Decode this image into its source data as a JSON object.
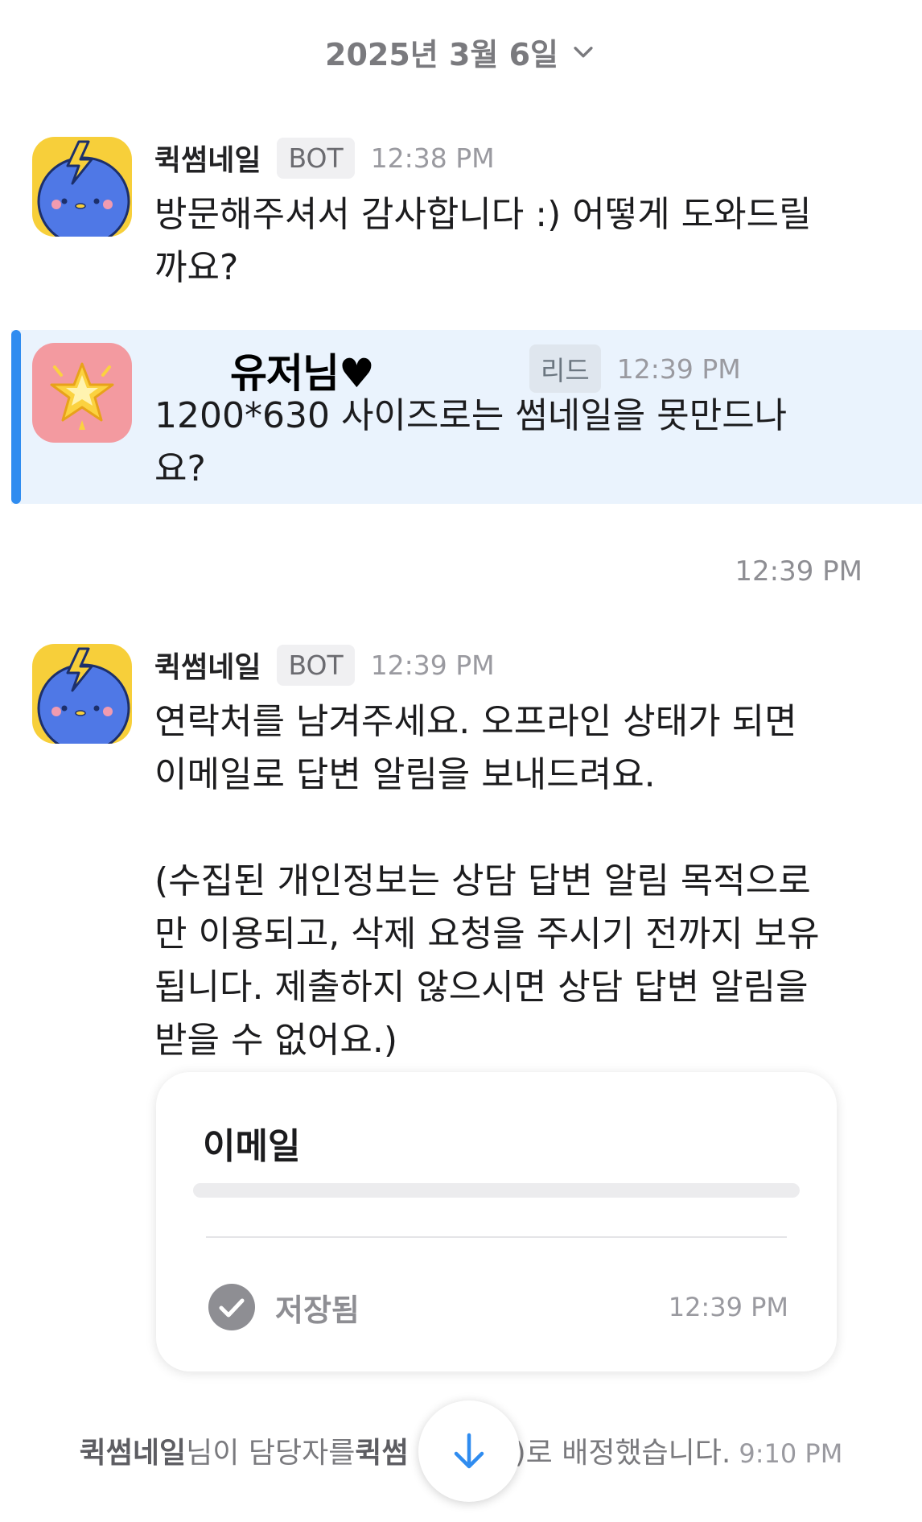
{
  "date_header": "2025년 3월 6일",
  "messages": [
    {
      "sender": "퀵썸네일",
      "badge": "BOT",
      "time": "12:38 PM",
      "text": "방문해주셔서 감사합니다 :) 어떻게 도와드릴\n까요?"
    },
    {
      "sender": "유저님♥",
      "badge": "리드",
      "time": "12:39 PM",
      "text": "1200*630 사이즈로는 썸네일을 못만드나\n요?"
    },
    {
      "sender": "퀵썸네일",
      "badge": "BOT",
      "time": "12:39 PM",
      "text": "연락처를 남겨주세요. 오프라인 상태가 되면\n이메일로 답변 알림을 보내드려요.\n\n(수집된 개인정보는 상담 답변 알림 목적으로\n만 이용되고, 삭제 요청을 주시기 전까지 보유\n됩니다. 제출하지 않으시면 상담 답변 알림을\n받을 수 없어요.)"
    }
  ],
  "standalone_time": "12:39 PM",
  "form_card": {
    "title": "이메일",
    "saved_label": "저장됨",
    "saved_time": "12:39 PM"
  },
  "system_message": {
    "actor": "퀵썸네일",
    "text1": "님이 담당자를 ",
    "assignee": "퀵썸",
    "text2": ")로 배정했습니다.",
    "time": "9:10 PM"
  },
  "colors": {
    "highlight_bg": "#eaf3fd",
    "accent_bar": "#2f8cf0",
    "bot_avatar_bg": "#f7cf3a",
    "bot_avatar_body": "#4f78e6",
    "user_avatar_bg": "#f39aa0",
    "scroll_arrow": "#2f8cf0"
  },
  "icons": {
    "date_toggle": "chevron-down-icon",
    "saved": "check-circle-icon",
    "scroll_down": "arrow-down-icon"
  }
}
